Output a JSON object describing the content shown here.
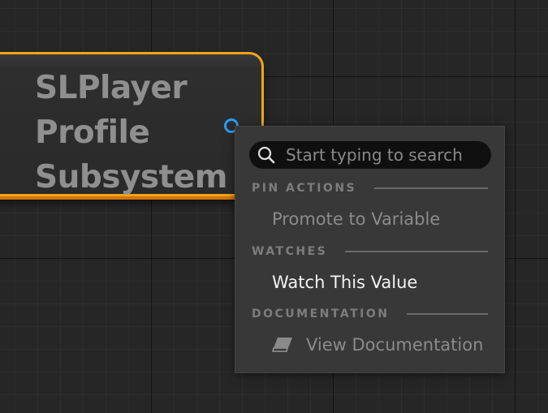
{
  "node": {
    "title_lines": [
      "SLPlayer",
      "Profile",
      "Subsystem"
    ],
    "border_color": "#f2a418",
    "pin_color": "#2b9cf0"
  },
  "context_menu": {
    "search": {
      "placeholder": "Start typing to search",
      "value": "",
      "icon": "search-icon"
    },
    "sections": [
      {
        "label": "PIN ACTIONS",
        "items": [
          {
            "label": "Promote to Variable",
            "enabled": false
          }
        ]
      },
      {
        "label": "WATCHES",
        "items": [
          {
            "label": "Watch This Value",
            "enabled": true
          }
        ]
      },
      {
        "label": "DOCUMENTATION",
        "items": [
          {
            "label": "View Documentation",
            "enabled": false,
            "icon": "book-icon"
          }
        ]
      }
    ]
  }
}
